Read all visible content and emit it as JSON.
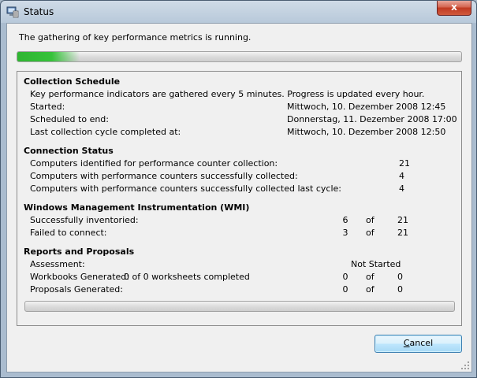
{
  "window": {
    "title": "Status",
    "close_label": "x"
  },
  "status_message": "The gathering of key performance metrics is running.",
  "top_progress": {
    "fraction": 0.14
  },
  "collection_schedule": {
    "heading": "Collection Schedule",
    "description": "Key performance indicators are gathered every 5 minutes. Progress is updated every hour.",
    "rows": [
      {
        "label": "Started:",
        "value": "Mittwoch, 10. Dezember 2008 12:45"
      },
      {
        "label": "Scheduled to end:",
        "value": "Donnerstag, 11. Dezember 2008 17:00"
      },
      {
        "label": "Last collection cycle completed at:",
        "value": "Mittwoch, 10. Dezember 2008 12:50"
      }
    ]
  },
  "connection_status": {
    "heading": "Connection Status",
    "rows": [
      {
        "label": "Computers identified for performance counter collection:",
        "value": "21"
      },
      {
        "label": "Computers with performance counters successfully collected:",
        "value": "4"
      },
      {
        "label": "Computers with performance counters successfully collected last cycle:",
        "value": "4"
      }
    ]
  },
  "wmi": {
    "heading": "Windows Management Instrumentation (WMI)",
    "rows": [
      {
        "label": "Successfully inventoried:",
        "count": "6",
        "of": "of",
        "total": "21"
      },
      {
        "label": "Failed to connect:",
        "count": "3",
        "of": "of",
        "total": "21"
      }
    ]
  },
  "reports": {
    "heading": "Reports and Proposals",
    "assessment": {
      "label": "Assessment:",
      "value": "Not Started"
    },
    "workbooks": {
      "label": "Workbooks Generated:",
      "detail": "0 of 0 worksheets completed",
      "count": "0",
      "of": "of",
      "total": "0"
    },
    "proposals": {
      "label": "Proposals Generated:",
      "count": "0",
      "of": "of",
      "total": "0"
    }
  },
  "bottom_progress": {
    "fraction": 0
  },
  "buttons": {
    "cancel_label": "Cancel",
    "cancel_mnemonic": "C",
    "cancel_rest": "ancel"
  }
}
